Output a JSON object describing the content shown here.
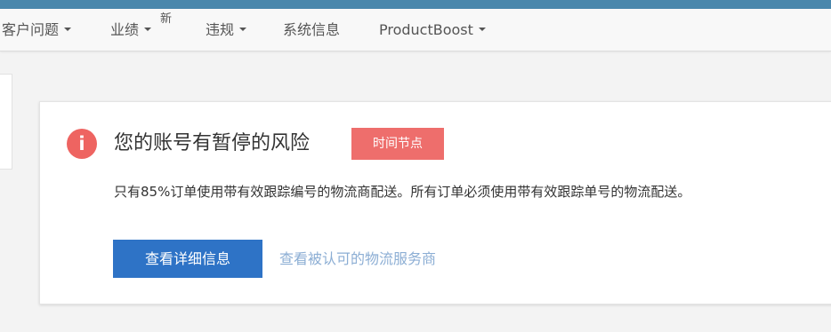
{
  "nav": {
    "items": [
      {
        "label": "客户问题",
        "has_dropdown": true
      },
      {
        "label": "业绩",
        "has_dropdown": true,
        "badge": "新"
      },
      {
        "label": "违规",
        "has_dropdown": true
      },
      {
        "label": "系统信息",
        "has_dropdown": false
      },
      {
        "label": "ProductBoost",
        "has_dropdown": true
      }
    ]
  },
  "alert": {
    "icon": "info-icon",
    "icon_glyph": "i",
    "title": "您的账号有暂停的风险",
    "tag": "时间节点",
    "description": "只有85%订单使用带有效跟踪编号的物流商配送。所有订单必须使用带有效跟踪单号的物流配送。",
    "primary_button": "查看详细信息",
    "secondary_link": "查看被认可的物流服务商"
  },
  "colors": {
    "topbar": "#4a87ac",
    "alert_red": "#ee6461",
    "primary_blue": "#2e73c6",
    "link_blue": "#8caed4"
  }
}
